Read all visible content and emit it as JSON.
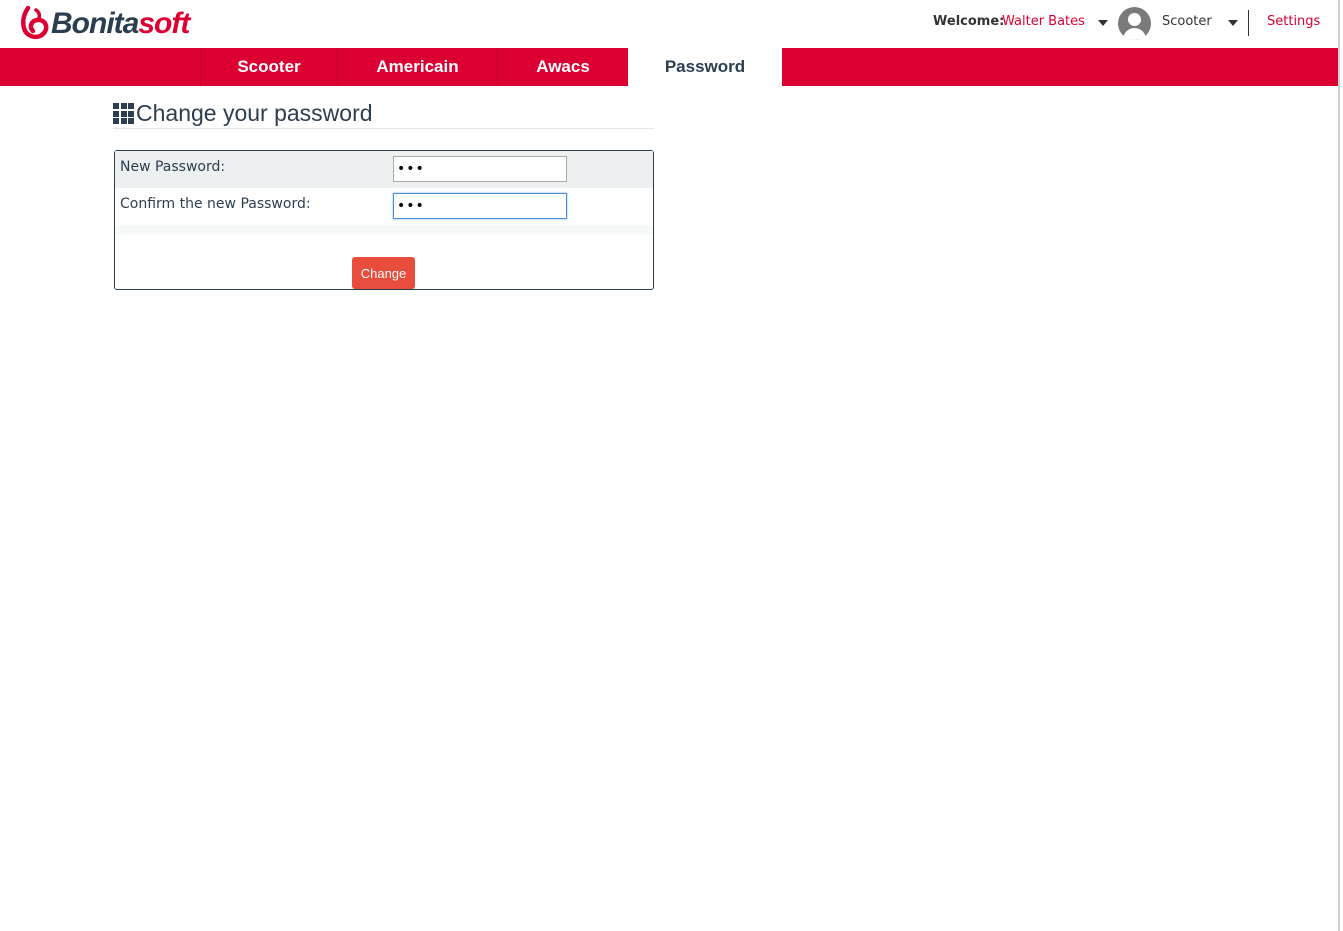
{
  "header": {
    "logo": {
      "brand": "Bonita",
      "brand_suffix": "soft"
    },
    "welcome_label": "Welcome:",
    "user_name": "Walter Bates",
    "app_name": "Scooter",
    "settings_label": "Settings"
  },
  "nav": {
    "tabs": [
      {
        "label": "Scooter",
        "active": false
      },
      {
        "label": "Americain",
        "active": false
      },
      {
        "label": "Awacs",
        "active": false
      },
      {
        "label": "Password",
        "active": true
      }
    ]
  },
  "main": {
    "title": "Change your password",
    "form": {
      "new_password_label": "New Password:",
      "new_password_value": "•••",
      "confirm_password_label": "Confirm the new Password:",
      "confirm_password_value": "•••",
      "submit_label": "Change"
    }
  },
  "colors": {
    "brand_red": "#dc0032",
    "button_red": "#e74c3c",
    "text_dark": "#2c3e50"
  }
}
